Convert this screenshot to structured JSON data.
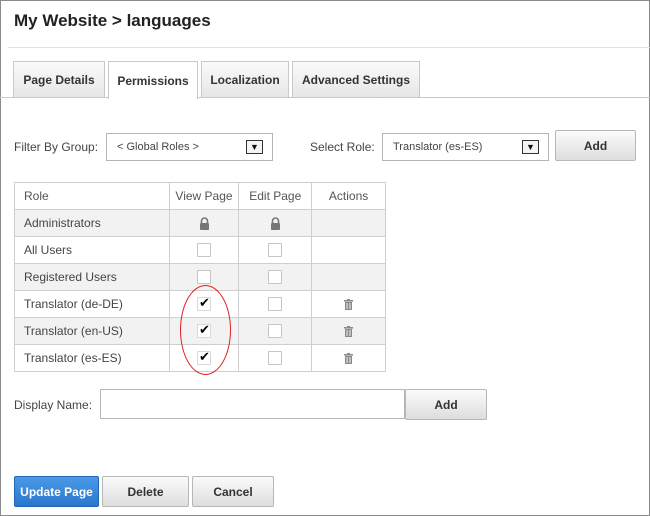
{
  "header": {
    "title": "My Website > languages"
  },
  "tabs": [
    {
      "label": "Page Details"
    },
    {
      "label": "Permissions"
    },
    {
      "label": "Localization"
    },
    {
      "label": "Advanced Settings"
    }
  ],
  "filters": {
    "filter_group_label": "Filter By Group:",
    "filter_group_value": "< Global Roles >",
    "select_role_label": "Select Role:",
    "select_role_value": "Translator (es-ES)",
    "add_label": "Add"
  },
  "table": {
    "headers": [
      "Role",
      "View Page",
      "Edit Page",
      "Actions"
    ],
    "rows": [
      {
        "role": "Administrators",
        "view": "locked",
        "edit": "locked",
        "action": ""
      },
      {
        "role": "All Users",
        "view": "unchecked",
        "edit": "unchecked",
        "action": ""
      },
      {
        "role": "Registered Users",
        "view": "unchecked",
        "edit": "unchecked",
        "action": ""
      },
      {
        "role": "Translator (de-DE)",
        "view": "checked",
        "edit": "unchecked",
        "action": "trash-icon"
      },
      {
        "role": "Translator (en-US)",
        "view": "checked",
        "edit": "unchecked",
        "action": "trash-icon"
      },
      {
        "role": "Translator (es-ES)",
        "view": "checked",
        "edit": "unchecked",
        "action": "trash-icon"
      }
    ]
  },
  "display_name": {
    "label": "Display Name:",
    "value": "",
    "add_label": "Add"
  },
  "footer": {
    "update_label": "Update Page",
    "delete_label": "Delete",
    "cancel_label": "Cancel"
  },
  "colors": {
    "primary_button": "#2a76cc",
    "annotation_circle": "#e01e1e"
  }
}
